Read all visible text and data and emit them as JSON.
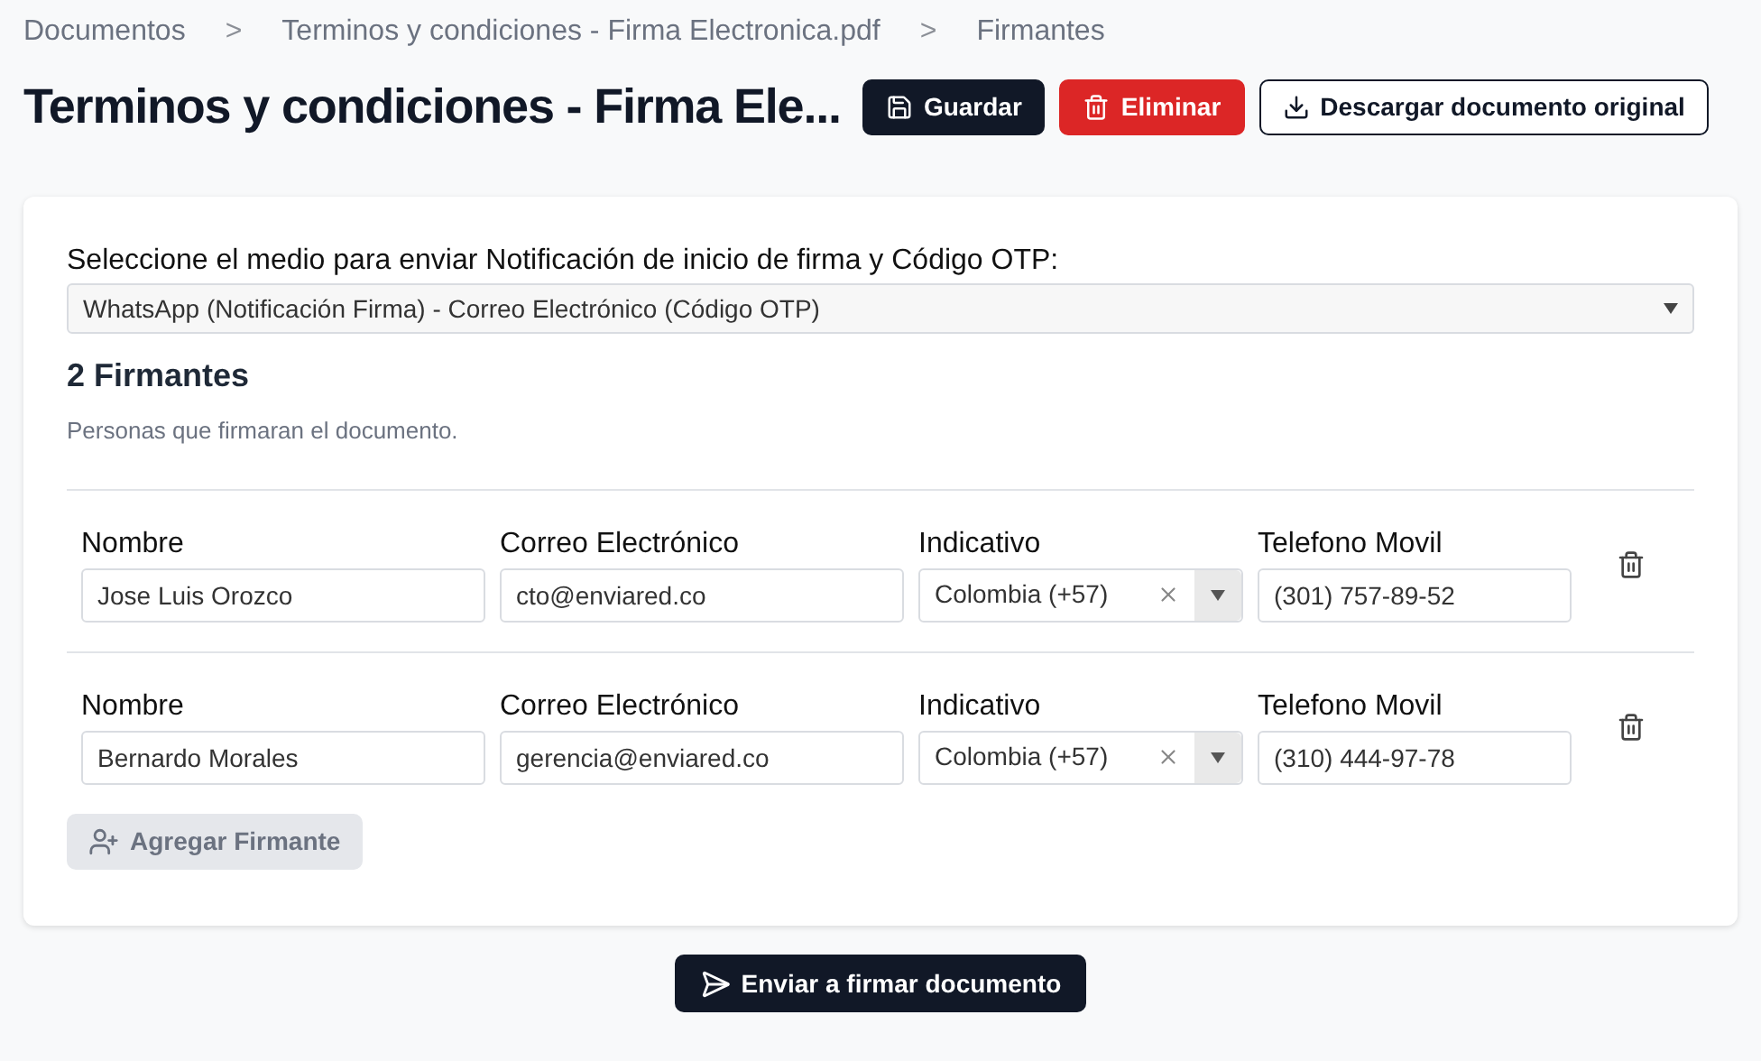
{
  "breadcrumb": [
    {
      "label": "Documentos"
    },
    {
      "label": "Terminos y condiciones - Firma Electronica.pdf"
    },
    {
      "label": "Firmantes"
    }
  ],
  "breadcrumb_separator": ">",
  "title": "Terminos y condiciones - Firma Ele...",
  "actions": [
    {
      "label": "Guardar",
      "kind": "save"
    },
    {
      "label": "Eliminar",
      "kind": "delete"
    },
    {
      "label": "Descargar documento original",
      "kind": "download"
    }
  ],
  "notification": {
    "label": "Seleccione el medio para enviar Notificación de inicio de firma y Código OTP:",
    "value": "WhatsApp (Notificación Firma) - Correo Electrónico (Código OTP)"
  },
  "signers_heading": "2 Firmantes",
  "signers_description": "Personas que firmaran el documento.",
  "signers": [
    {
      "name_label": "Nombre",
      "name": "Jose Luis Orozco",
      "email_label": "Correo Electrónico",
      "email": "cto@enviared.co",
      "code_label": "Indicativo",
      "code": "Colombia (+57)",
      "phone_label": "Telefono Movil",
      "phone": "(301) 757-89-52"
    },
    {
      "name_label": "Nombre",
      "name": "Bernardo Morales",
      "email_label": "Correo Electrónico",
      "email": "gerencia@enviared.co",
      "code_label": "Indicativo",
      "code": "Colombia (+57)",
      "phone_label": "Telefono Movil",
      "phone": "(310) 444-97-78"
    }
  ],
  "add_signer": {
    "label": "Agregar Firmante",
    "disabled": true
  },
  "submit": {
    "label": "Enviar a firmar documento"
  }
}
